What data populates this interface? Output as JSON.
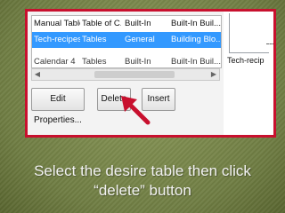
{
  "dialog": {
    "rows": [
      {
        "name": "Manual Table",
        "gallery": "Table of C...",
        "category": "Built-In",
        "template": "Built-In Buil...",
        "selected": false
      },
      {
        "name": "Tech-recipes",
        "gallery": "Tables",
        "category": "General",
        "template": "Building Blo...",
        "selected": true
      },
      {
        "name": "Calendar 4",
        "gallery": "Tables",
        "category": "Built-In",
        "template": "Built-In Buil...",
        "selected": false
      }
    ],
    "buttons": {
      "edit_properties": "Edit Properties...",
      "delete": "Delete",
      "insert": "Insert"
    }
  },
  "preview": {
    "label": "Tech-recip"
  },
  "caption": {
    "line1": "Select the desire table then click",
    "line2": "“delete” button"
  },
  "colors": {
    "frame": "#c8102e",
    "selection": "#3399ff",
    "slide_bg": "#7a8a4c",
    "arrow": "#c8102e"
  }
}
